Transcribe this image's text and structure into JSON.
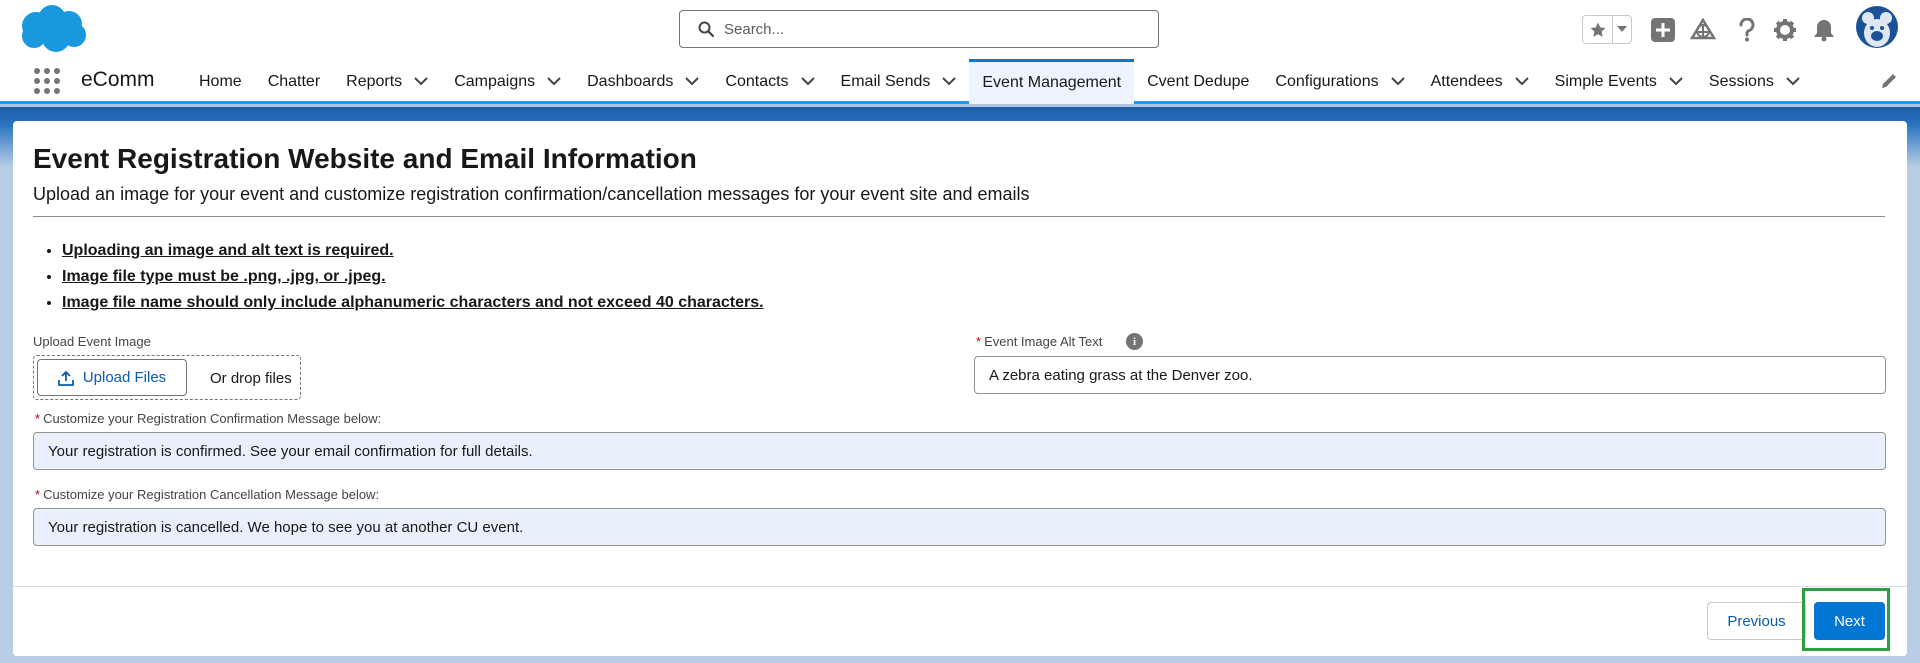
{
  "header": {
    "logo_icon": "salesforce-cloud-logo",
    "search": {
      "placeholder": "Search...",
      "value": ""
    },
    "icons": [
      "favorites-star-icon",
      "add-icon",
      "trailhead-icon",
      "help-icon",
      "setup-gear-icon",
      "notifications-bell-icon",
      "avatar"
    ]
  },
  "nav": {
    "app_name": "eComm",
    "items": [
      {
        "label": "Home",
        "dropdown": false,
        "active": false
      },
      {
        "label": "Chatter",
        "dropdown": false,
        "active": false
      },
      {
        "label": "Reports",
        "dropdown": true,
        "active": false
      },
      {
        "label": "Campaigns",
        "dropdown": true,
        "active": false
      },
      {
        "label": "Dashboards",
        "dropdown": true,
        "active": false
      },
      {
        "label": "Contacts",
        "dropdown": true,
        "active": false
      },
      {
        "label": "Email Sends",
        "dropdown": true,
        "active": false
      },
      {
        "label": "Event Management",
        "dropdown": false,
        "active": true
      },
      {
        "label": "Cvent Dedupe",
        "dropdown": false,
        "active": false
      },
      {
        "label": "Configurations",
        "dropdown": true,
        "active": false
      },
      {
        "label": "Attendees",
        "dropdown": true,
        "active": false
      },
      {
        "label": "Simple Events",
        "dropdown": true,
        "active": false
      },
      {
        "label": "Sessions",
        "dropdown": true,
        "active": false
      }
    ]
  },
  "page": {
    "title": "Event Registration Website and Email Information",
    "subtitle": "Upload an image for your event and customize registration confirmation/cancellation messages for your event site and emails",
    "rules": [
      "Uploading an image and alt text is required.",
      "Image file type must be .png, .jpg, or .jpeg.",
      "Image file name should only include alphanumeric characters and not exceed 40 characters."
    ]
  },
  "form": {
    "upload": {
      "label": "Upload Event Image",
      "button_label": "Upload Files",
      "drop_text": "Or drop files"
    },
    "alt_text": {
      "required_mark": "*",
      "label": "Event Image Alt Text",
      "info_icon": "i",
      "value": "A zebra eating grass at the Denver zoo."
    },
    "confirmation": {
      "required_mark": "*",
      "label": "Customize your Registration Confirmation Message below:",
      "value": "Your registration is confirmed. See your email confirmation for full details."
    },
    "cancellation": {
      "required_mark": "*",
      "label": "Customize your Registration Cancellation Message below:",
      "value": "Your registration is cancelled. We hope to see you at another CU event."
    }
  },
  "footer": {
    "previous_label": "Previous",
    "next_label": "Next",
    "highlight_color": "#2e9e45"
  },
  "colors": {
    "brand_blue": "#0176d3",
    "link_blue": "#0b5cab",
    "required_red": "#ba0517"
  }
}
